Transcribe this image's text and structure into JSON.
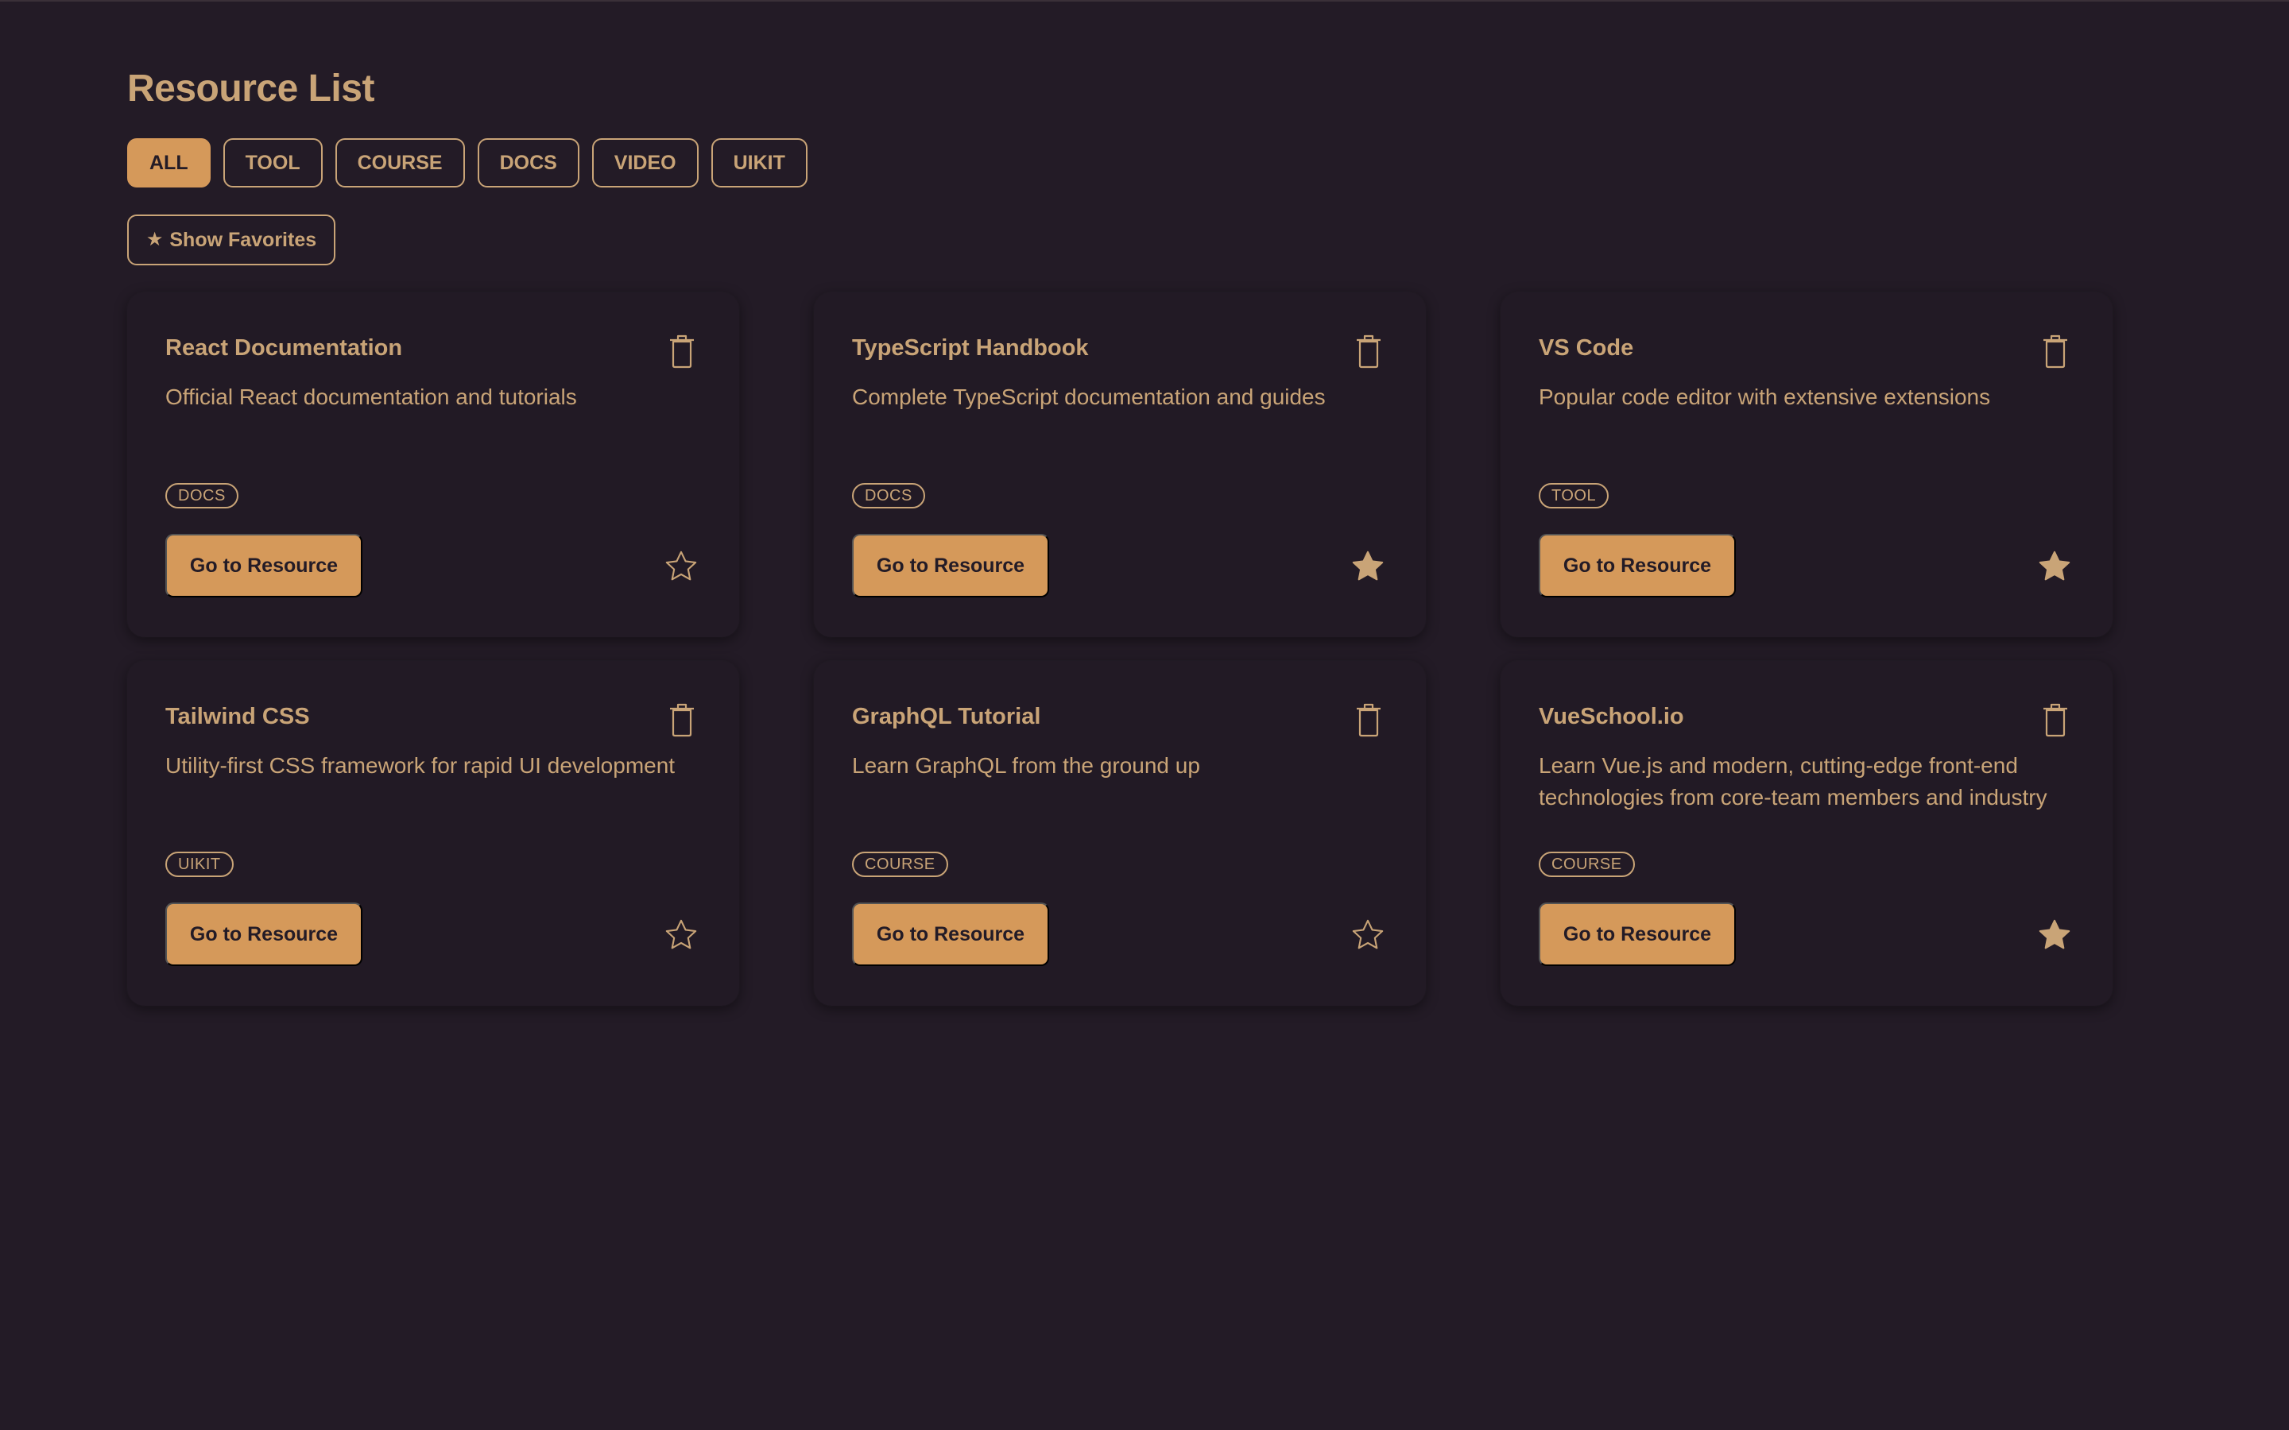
{
  "page": {
    "title": "Resource List"
  },
  "filters": [
    {
      "label": "ALL",
      "active": true
    },
    {
      "label": "TOOL",
      "active": false
    },
    {
      "label": "COURSE",
      "active": false
    },
    {
      "label": "DOCS",
      "active": false
    },
    {
      "label": "VIDEO",
      "active": false
    },
    {
      "label": "UIKIT",
      "active": false
    }
  ],
  "favorites_toggle": {
    "icon": "star-icon",
    "label": "Show Favorites"
  },
  "resources": [
    {
      "title": "React Documentation",
      "description": "Official React documentation and tutorials",
      "tag": "DOCS",
      "button": "Go to Resource",
      "favorite": false
    },
    {
      "title": "TypeScript Handbook",
      "description": "Complete TypeScript documentation and guides",
      "tag": "DOCS",
      "button": "Go to Resource",
      "favorite": true
    },
    {
      "title": "VS Code",
      "description": "Popular code editor with extensive extensions",
      "tag": "TOOL",
      "button": "Go to Resource",
      "favorite": true
    },
    {
      "title": "Tailwind CSS",
      "description": "Utility-first CSS framework for rapid UI development",
      "tag": "UIKIT",
      "button": "Go to Resource",
      "favorite": false
    },
    {
      "title": "GraphQL Tutorial",
      "description": "Learn GraphQL from the ground up",
      "tag": "COURSE",
      "button": "Go to Resource",
      "favorite": false
    },
    {
      "title": "VueSchool.io",
      "description": "Learn Vue.js and modern, cutting-edge front-end technologies from core-team members and industry experts with our premium tutorials and video",
      "tag": "COURSE",
      "button": "Go to Resource",
      "favorite": true
    }
  ],
  "colors": {
    "background": "#231b26",
    "card": "#221a25",
    "accent": "#d5995a",
    "text": "#c9a477"
  }
}
